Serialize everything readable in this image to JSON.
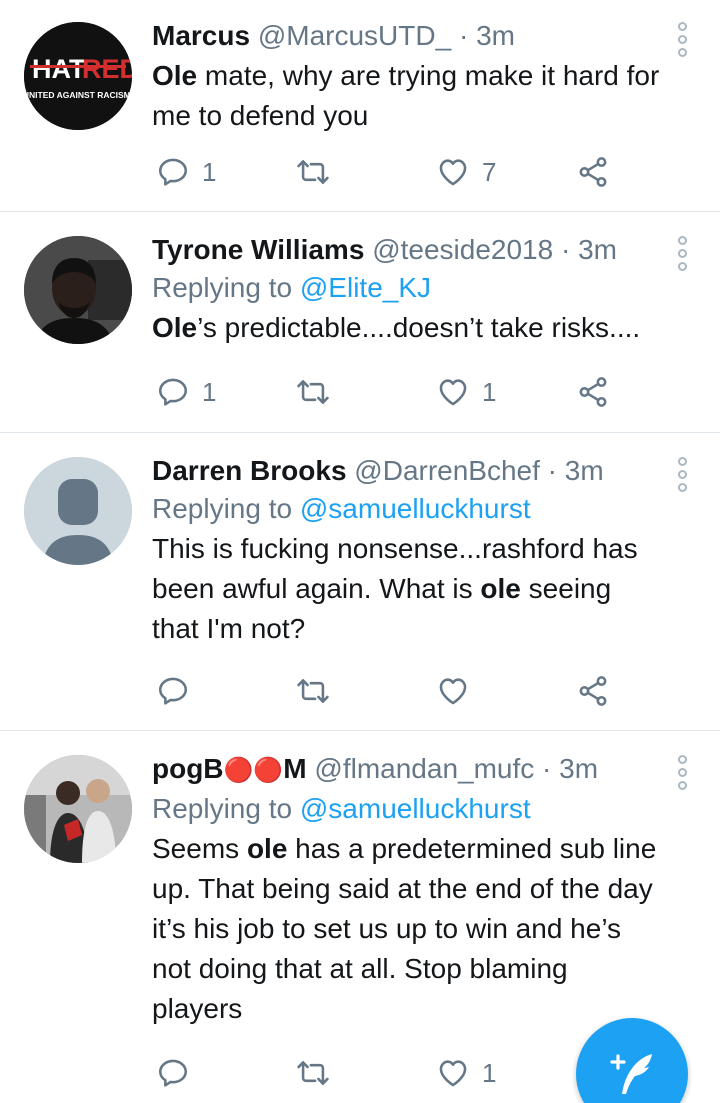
{
  "tweets": [
    {
      "name": "Marcus",
      "handle": "@MarcusUTD_",
      "time": "3m",
      "body_bold": "Ole",
      "body_rest": " mate, why are trying make it hard for me to defend you",
      "replies": "1",
      "retweets": "",
      "likes": "7",
      "avatar_logo_top_a": "HAT",
      "avatar_logo_top_b": "RED",
      "avatar_logo_bottom": "UNITED AGAINST RACISM."
    },
    {
      "name": "Tyrone Williams",
      "handle": "@teeside2018",
      "time": "3m",
      "reply_prefix": "Replying to ",
      "reply_to": "@Elite_KJ",
      "body_bold": "Ole",
      "body_rest": "’s predictable....doesn’t take risks....",
      "replies": "1",
      "retweets": "",
      "likes": "1"
    },
    {
      "name": "Darren Brooks",
      "handle": "@DarrenBchef",
      "time": "3m",
      "reply_prefix": "Replying to ",
      "reply_to": "@samuelluckhurst",
      "body_pre": "This is fucking nonsense...rashford has been awful again. What is ",
      "body_bold": "ole",
      "body_rest": " seeing that I'm not?",
      "replies": "",
      "retweets": "",
      "likes": ""
    },
    {
      "name_a": "pogB",
      "name_emoji": "🔴🔴",
      "name_b": "M",
      "handle": "@flmandan_mufc",
      "time": "3m",
      "reply_prefix": "Replying to ",
      "reply_to": "@samuelluckhurst",
      "body_pre": "Seems ",
      "body_bold": "ole",
      "body_rest": " has a predetermined sub line up. That being said at the end of the day it’s his job to set us up to win and he’s not doing that at all. Stop blaming players",
      "replies": "",
      "retweets": "",
      "likes": "1"
    }
  ],
  "separator": " · ",
  "icons": {
    "reply": "reply-icon",
    "retweet": "retweet-icon",
    "like": "heart-icon",
    "share": "share-icon",
    "more": "more-vertical-icon",
    "compose": "compose-tweet-icon"
  },
  "colors": {
    "accent": "#1da1f2",
    "text": "#14171a",
    "muted": "#657786",
    "divider": "#e1e8ed"
  }
}
